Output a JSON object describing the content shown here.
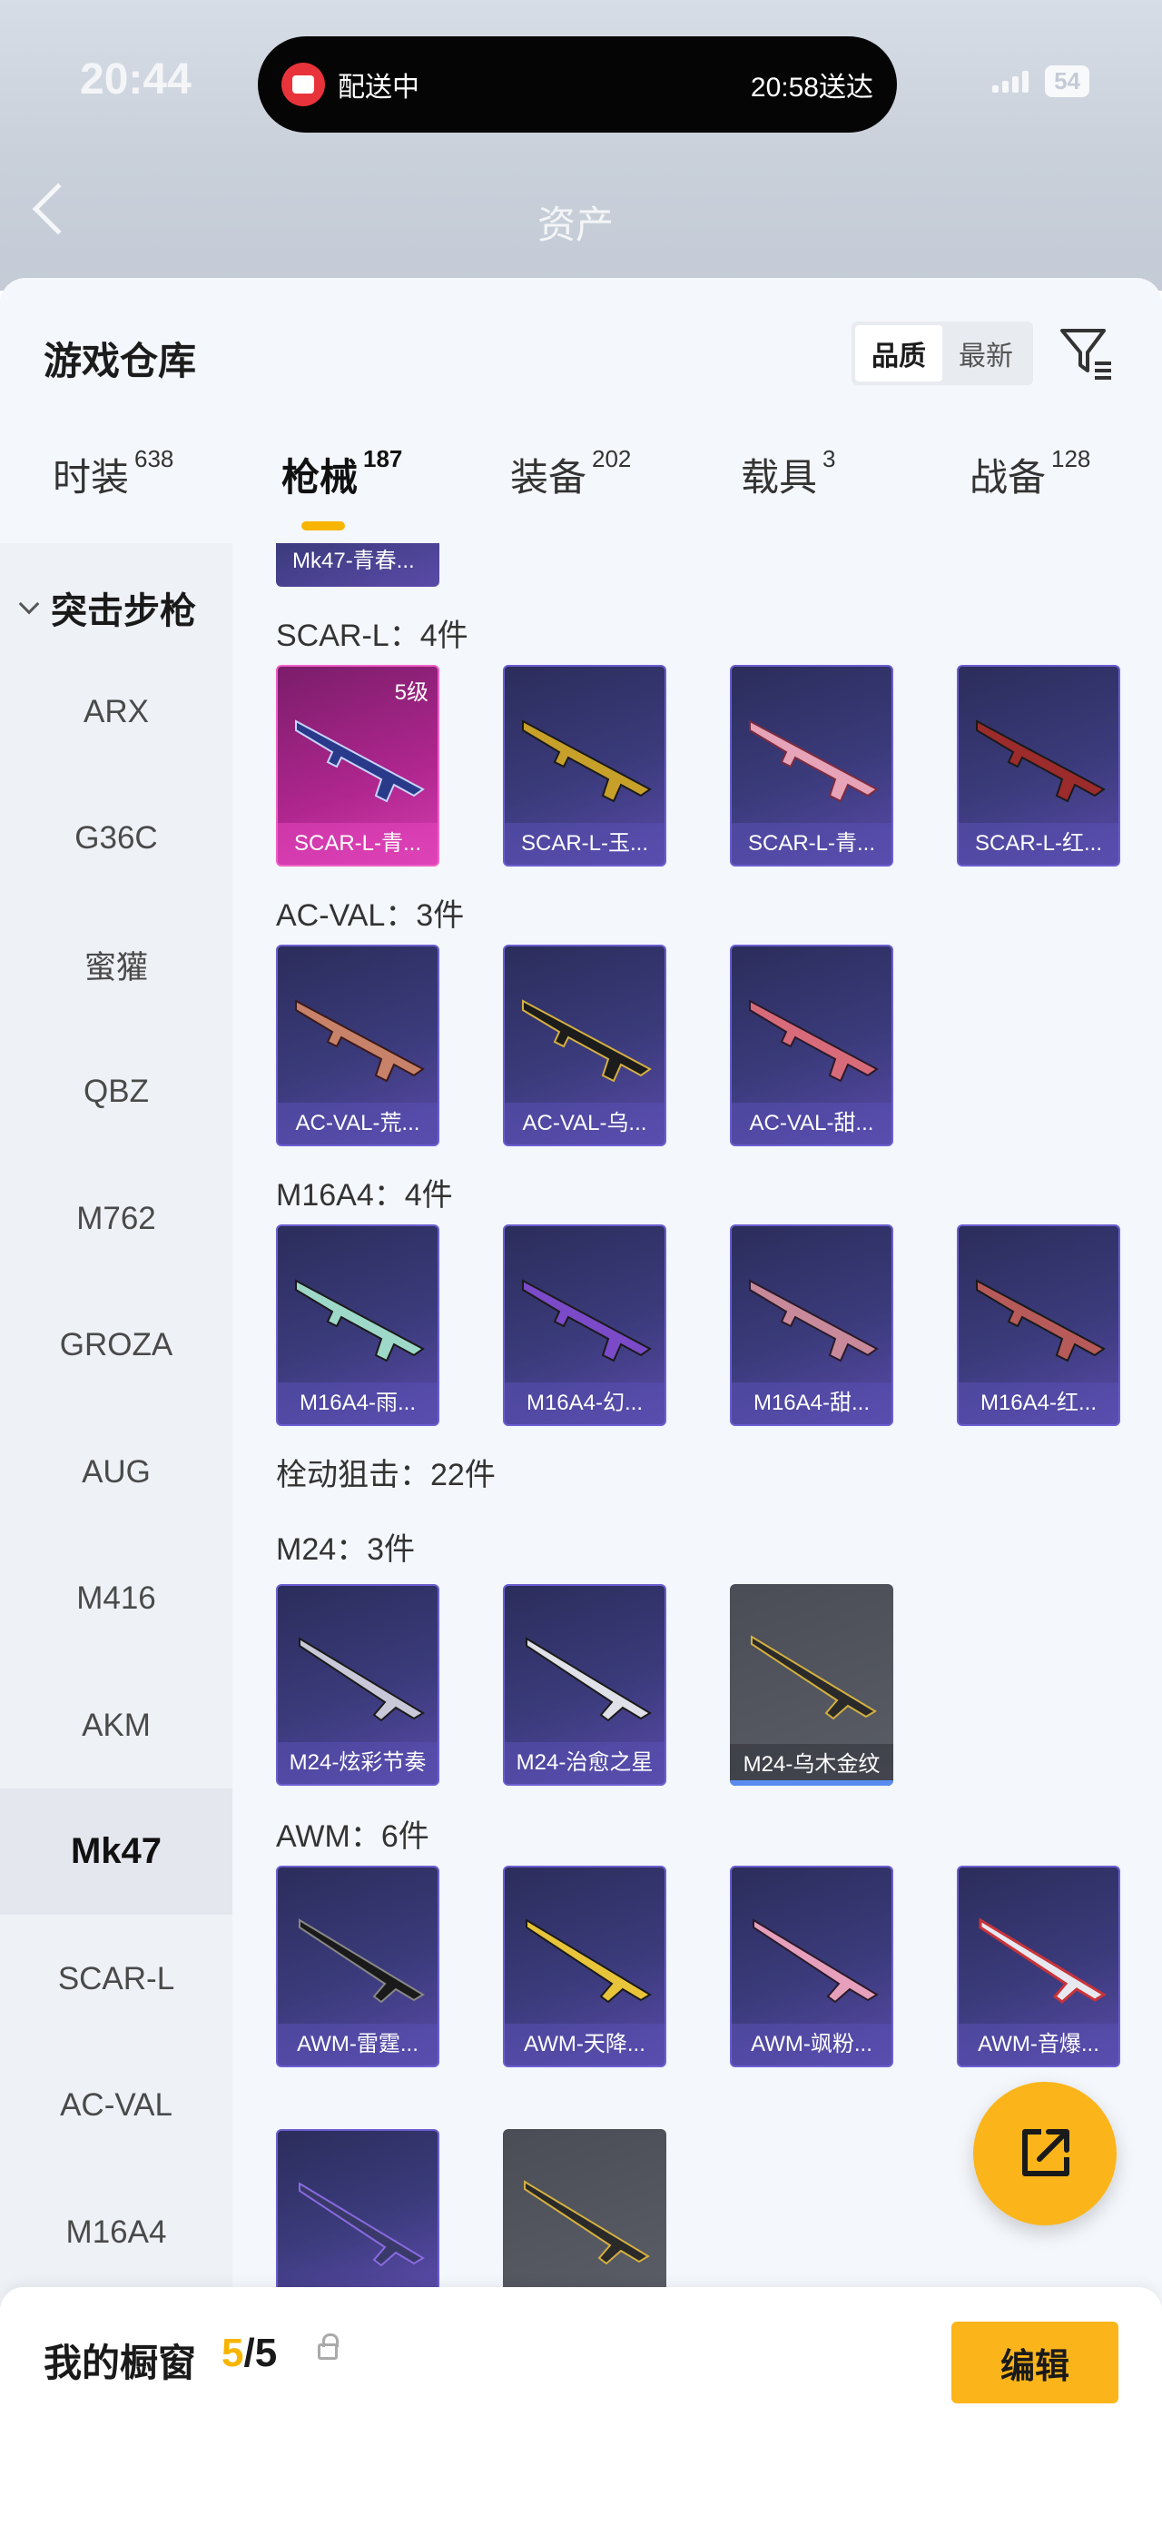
{
  "status": {
    "time": "20:44",
    "battery": "54"
  },
  "island": {
    "label": "配送中",
    "eta": "20:58送达"
  },
  "header": {
    "title": "资产"
  },
  "sheet": {
    "title": "游戏仓库",
    "sort": {
      "quality": "品质",
      "latest": "最新"
    },
    "tabs": [
      {
        "label": "时装",
        "count": "638"
      },
      {
        "label": "枪械",
        "count": "187"
      },
      {
        "label": "装备",
        "count": "202"
      },
      {
        "label": "载具",
        "count": "3"
      },
      {
        "label": "战备",
        "count": "128"
      }
    ]
  },
  "sidebar": {
    "header": "突击步枪",
    "items": [
      "ARX",
      "G36C",
      "蜜獾",
      "QBZ",
      "M762",
      "GROZA",
      "AUG",
      "M416",
      "AKM",
      "Mk47",
      "SCAR-L",
      "AC-VAL",
      "M16A4"
    ],
    "selected": "Mk47"
  },
  "content": {
    "partial_card": "Mk47-青春...",
    "groups": [
      {
        "label": "SCAR-L：4件",
        "cards": [
          {
            "name": "SCAR-L-青...",
            "level": "5级"
          },
          {
            "name": "SCAR-L-玉..."
          },
          {
            "name": "SCAR-L-青..."
          },
          {
            "name": "SCAR-L-红..."
          }
        ]
      },
      {
        "label": "AC-VAL：3件",
        "cards": [
          {
            "name": "AC-VAL-荒..."
          },
          {
            "name": "AC-VAL-乌..."
          },
          {
            "name": "AC-VAL-甜..."
          }
        ]
      },
      {
        "label": "M16A4：4件",
        "cards": [
          {
            "name": "M16A4-雨..."
          },
          {
            "name": "M16A4-幻..."
          },
          {
            "name": "M16A4-甜..."
          },
          {
            "name": "M16A4-红..."
          }
        ]
      },
      {
        "label": "栓动狙击：22件"
      },
      {
        "label": "M24：3件",
        "cards": [
          {
            "name": "M24-炫彩节奏"
          },
          {
            "name": "M24-治愈之星"
          },
          {
            "name": "M24-乌木金纹"
          }
        ]
      },
      {
        "label": "AWM：6件",
        "cards": [
          {
            "name": "AWM-雷霆..."
          },
          {
            "name": "AWM-天降..."
          },
          {
            "name": "AWM-飒粉..."
          },
          {
            "name": "AWM-音爆..."
          }
        ]
      }
    ]
  },
  "showcase": {
    "title": "我的橱窗",
    "used": "5",
    "total": "/5",
    "edit": "编辑"
  },
  "colors": {
    "accent": "#fbb51a",
    "purple_rarity": "#5a4aa8",
    "pink_rarity": "#d63fb0",
    "gray_rarity": "#5a5d66"
  }
}
